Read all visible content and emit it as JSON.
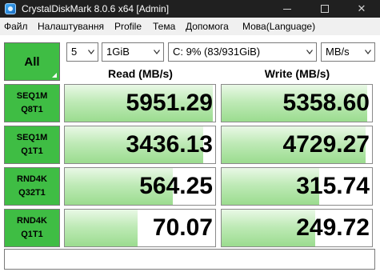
{
  "window": {
    "title": "CrystalDiskMark 8.0.6 x64 [Admin]",
    "controls": {
      "minimize": "—",
      "maximize": "☐",
      "close": "✕"
    }
  },
  "menu": [
    "Файл",
    "Налаштування",
    "Profile",
    "Тема",
    "Допомога",
    "Мова(Language)"
  ],
  "toolbar": {
    "all_label": "All",
    "count": "5",
    "size": "1GiB",
    "drive": "C: 9% (83/931GiB)",
    "unit": "MB/s"
  },
  "columns": {
    "read": "Read (MB/s)",
    "write": "Write (MB/s)"
  },
  "max_scale_mbs": 7000,
  "tests": [
    {
      "line1": "SEQ1M",
      "line2": "Q8T1",
      "read": "5951.29",
      "write": "5358.60"
    },
    {
      "line1": "SEQ1M",
      "line2": "Q1T1",
      "read": "3436.13",
      "write": "4729.27"
    },
    {
      "line1": "RND4K",
      "line2": "Q32T1",
      "read": "564.25",
      "write": "315.74"
    },
    {
      "line1": "RND4K",
      "line2": "Q1T1",
      "read": "70.07",
      "write": "249.72"
    }
  ],
  "status": "",
  "colors": {
    "accent_green": "#3fbd44",
    "titlebar": "#202020",
    "bar_green": "#9bdc8f"
  }
}
